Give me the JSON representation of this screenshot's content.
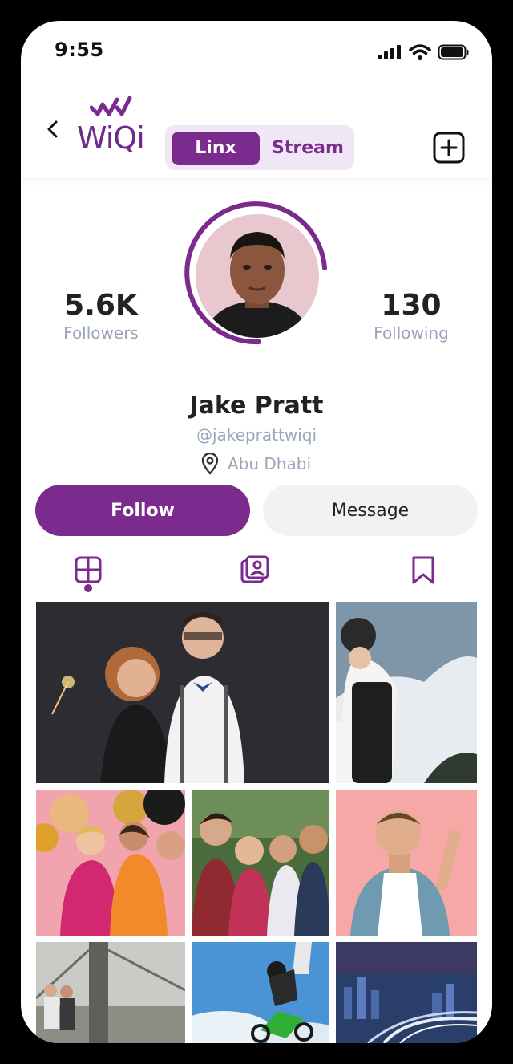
{
  "status": {
    "time": "9:55"
  },
  "header": {
    "logo_text": "WiQi",
    "tabs": [
      {
        "label": "Linx",
        "active": true
      },
      {
        "label": "Stream",
        "active": false
      }
    ]
  },
  "profile": {
    "followers_count": "5.6K",
    "followers_label": "Followers",
    "following_count": "130",
    "following_label": "Following",
    "name": "Jake Pratt",
    "handle": "@jakeprattwiqi",
    "location": "Abu Dhabi"
  },
  "actions": {
    "follow_label": "Follow",
    "message_label": "Message"
  },
  "content_tabs": [
    "grid-icon",
    "gallery-icon",
    "bookmark-icon"
  ],
  "colors": {
    "accent": "#7b2a8e",
    "muted": "#9aa5b8"
  },
  "grid": [
    {
      "description": "party couple photo"
    },
    {
      "description": "snowboarder photo"
    },
    {
      "description": "women with balloons photo"
    },
    {
      "description": "friends group selfie"
    },
    {
      "description": "man pointing photo"
    },
    {
      "description": "bridge couple photo"
    },
    {
      "description": "motocross jump photo"
    },
    {
      "description": "city night highway photo"
    }
  ]
}
